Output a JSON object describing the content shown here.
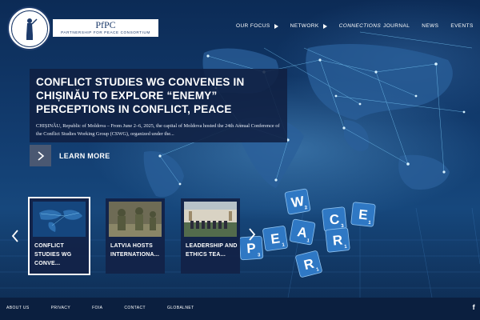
{
  "header": {
    "brand_abbr": "PfPC",
    "brand_full": "PARTNERSHIP FOR PEACE CONSORTIUM"
  },
  "nav": {
    "our_focus": "OUR FOCUS",
    "network": "NETWORK",
    "journal_italic": "CONNECTIONS",
    "journal": "JOURNAL",
    "news": "NEWS",
    "events": "EVENTS"
  },
  "hero": {
    "title": "CONFLICT STUDIES WG CONVENES IN CHIȘINĂU TO EXPLORE “ENEMY” PERCEPTIONS IN CONFLICT, PEACE",
    "excerpt": "CHIȘINĂU, Republic of Moldova – From June 2–6, 2025, the capital of Moldova hosted the 24th Annual Conference of the Conflict Studies Working Group (CSWG), organized under the...",
    "learn_more": "LEARN MORE"
  },
  "carousel": {
    "tiles": [
      {
        "caption": "CONFLICT STUDIES WG CONVE..."
      },
      {
        "caption": "LATVIA HOSTS INTERNATIONA..."
      },
      {
        "caption": "LEADERSHIP AND ETHICS TEA..."
      }
    ]
  },
  "scrabble": {
    "letters": [
      "W",
      "E",
      "C",
      "E",
      "P",
      "E",
      "A",
      "R",
      "R"
    ],
    "subscripts": [
      "2",
      "1",
      "3",
      "1",
      "3",
      "1",
      "1",
      "1",
      "1"
    ]
  },
  "footer": {
    "links": [
      "ABOUT US",
      "PRIVACY",
      "FOIA",
      "CONTACT",
      "GLOBALNET"
    ],
    "facebook": "f"
  },
  "colors": {
    "nav_bg": "#0c2346",
    "card_bg": "#102042",
    "footer_bg": "#0b1f3f",
    "tile_blue": "#2f78c4"
  }
}
